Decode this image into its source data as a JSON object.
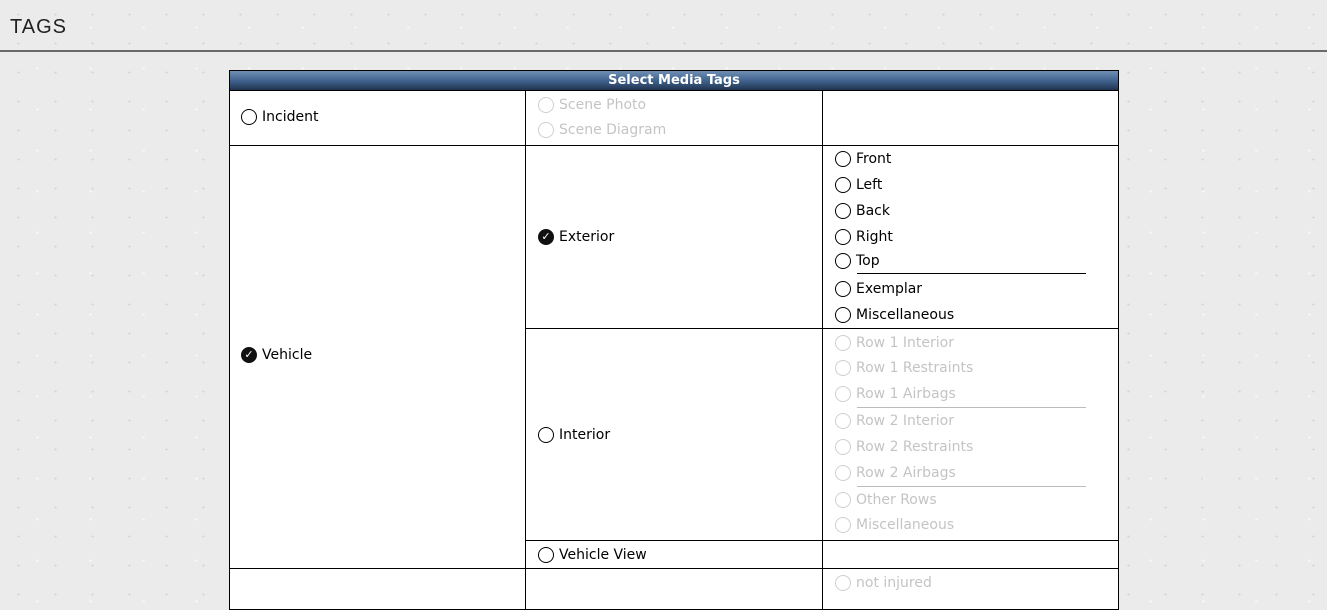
{
  "page": {
    "title": "TAGS"
  },
  "panel": {
    "header": "Select Media Tags"
  },
  "incident": {
    "label": "Incident",
    "options": [
      "Scene Photo",
      "Scene Diagram"
    ]
  },
  "vehicle": {
    "label": "Vehicle",
    "checked": true,
    "exterior": {
      "label": "Exterior",
      "checked": true,
      "options": [
        "Front",
        "Left",
        "Back",
        "Right",
        "Top",
        "Exemplar",
        "Miscellaneous"
      ]
    },
    "interior": {
      "label": "Interior",
      "options": [
        "Row 1 Interior",
        "Row 1 Restraints",
        "Row 1 Airbags",
        "Row 2 Interior",
        "Row 2 Restraints",
        "Row 2 Airbags",
        "Other Rows",
        "Miscellaneous"
      ]
    },
    "vehicle_view": {
      "label": "Vehicle View"
    }
  },
  "occupant": {
    "options": [
      "not injured"
    ]
  },
  "icons": {
    "checked": "check-circle-icon",
    "unchecked": "radio-empty-icon"
  }
}
